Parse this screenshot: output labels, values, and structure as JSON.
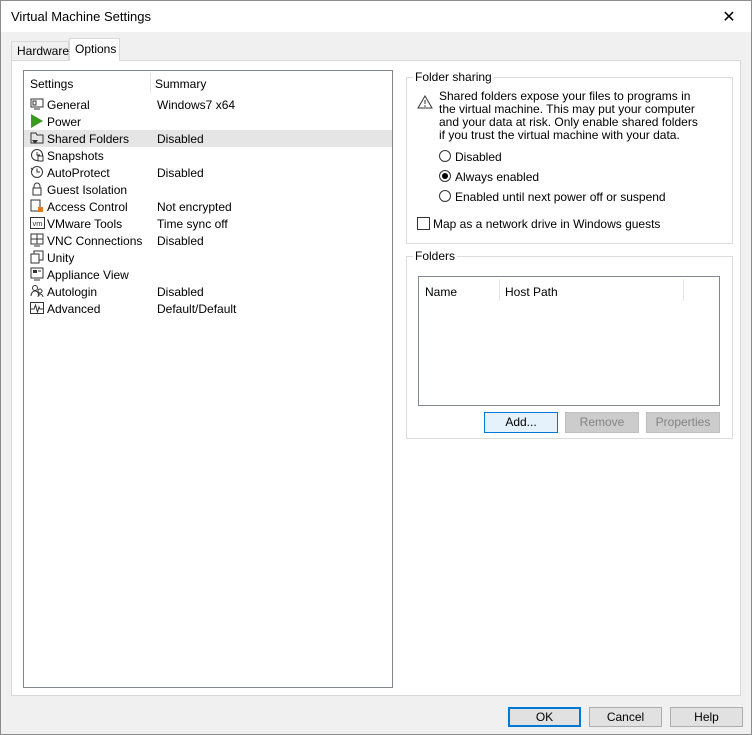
{
  "window": {
    "title": "Virtual Machine Settings",
    "close_glyph": "✕"
  },
  "tabs": [
    {
      "label": "Hardware",
      "active": false
    },
    {
      "label": "Options",
      "active": true
    }
  ],
  "settings": {
    "col_settings": "Settings",
    "col_summary": "Summary",
    "items": [
      {
        "label": "General",
        "summary": "Windows7 x64",
        "icon": "general-icon"
      },
      {
        "label": "Power",
        "summary": "",
        "icon": "power-play-icon"
      },
      {
        "label": "Shared Folders",
        "summary": "Disabled",
        "icon": "shared-folders-icon",
        "selected": true
      },
      {
        "label": "Snapshots",
        "summary": "",
        "icon": "snapshots-icon"
      },
      {
        "label": "AutoProtect",
        "summary": "Disabled",
        "icon": "autoprotect-clock-icon"
      },
      {
        "label": "Guest Isolation",
        "summary": "",
        "icon": "lock-icon"
      },
      {
        "label": "Access Control",
        "summary": "Not encrypted",
        "icon": "access-control-icon"
      },
      {
        "label": "VMware Tools",
        "summary": "Time sync off",
        "icon": "vm-icon",
        "icon_text": "vm"
      },
      {
        "label": "VNC Connections",
        "summary": "Disabled",
        "icon": "vnc-icon"
      },
      {
        "label": "Unity",
        "summary": "",
        "icon": "unity-icon"
      },
      {
        "label": "Appliance View",
        "summary": "",
        "icon": "appliance-view-icon"
      },
      {
        "label": "Autologin",
        "summary": "Disabled",
        "icon": "autologin-users-icon"
      },
      {
        "label": "Advanced",
        "summary": "Default/Default",
        "icon": "advanced-pulse-icon"
      }
    ]
  },
  "folder_sharing": {
    "legend": "Folder sharing",
    "warning": "Shared folders expose your files to programs in the virtual machine. This may put your computer and your data at risk. Only enable shared folders if you trust the virtual machine with your data.",
    "options": [
      {
        "label": "Disabled",
        "checked": false
      },
      {
        "label": "Always enabled",
        "checked": true
      },
      {
        "label": "Enabled until next power off or suspend",
        "checked": false
      }
    ],
    "map_drive_label": "Map as a network drive in Windows guests",
    "map_drive_checked": false
  },
  "folders": {
    "legend": "Folders",
    "col_name": "Name",
    "col_host_path": "Host Path",
    "add_label": "Add...",
    "remove_label": "Remove",
    "properties_label": "Properties"
  },
  "footer": {
    "ok_label": "OK",
    "cancel_label": "Cancel",
    "help_label": "Help"
  },
  "colors": {
    "accent": "#0078d7",
    "power_green": "#3a9c1f",
    "selected_row": "#e5e5e5"
  }
}
